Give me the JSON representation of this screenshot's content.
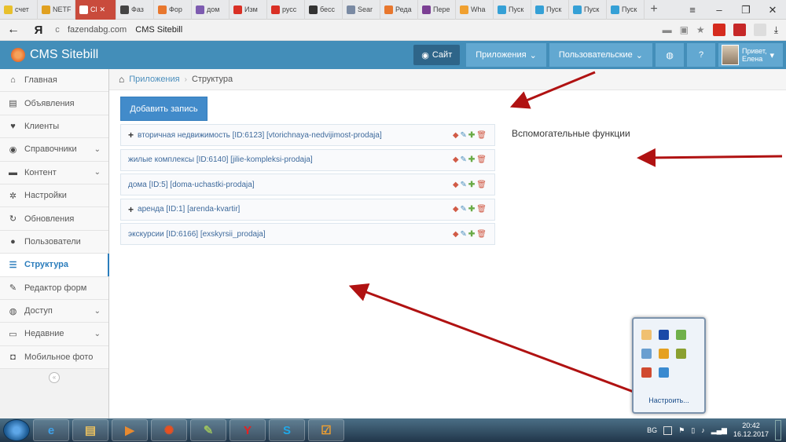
{
  "browser": {
    "tabs": [
      {
        "label": "счет",
        "color": "#e8c02c"
      },
      {
        "label": "NETF",
        "color": "#e0a020"
      },
      {
        "label": "Cl",
        "color": "#ffffff",
        "active": true
      },
      {
        "label": "Фаз",
        "color": "#444444"
      },
      {
        "label": "Фор",
        "color": "#e8772e"
      },
      {
        "label": "дом",
        "color": "#7d5bb0"
      },
      {
        "label": "Изм",
        "color": "#d93025"
      },
      {
        "label": "русс",
        "color": "#d93025"
      },
      {
        "label": "бесс",
        "color": "#333333"
      },
      {
        "label": "Sear",
        "color": "#7a8aa3"
      },
      {
        "label": "Реда",
        "color": "#e8772e"
      },
      {
        "label": "Пере",
        "color": "#7b3f94"
      },
      {
        "label": "Wha",
        "color": "#f0a030"
      },
      {
        "label": "Пуск",
        "color": "#35a0d6"
      },
      {
        "label": "Пуск",
        "color": "#35a0d6"
      },
      {
        "label": "Пуск",
        "color": "#35a0d6"
      },
      {
        "label": "Пуск",
        "color": "#35a0d6"
      }
    ],
    "new_tab": "+",
    "address": {
      "domain": "fazendabg.com",
      "page_title": "CMS Sitebill"
    }
  },
  "header": {
    "brand": "CMS Sitebill",
    "site_button": "Сайт",
    "apps_menu": "Приложения",
    "user_menu": "Пользовательские",
    "greeting_line1": "Привет,",
    "greeting_line2": "Елена"
  },
  "sidebar": {
    "items": [
      {
        "label": "Главная",
        "icon": "home-icon",
        "glyph": "⌂"
      },
      {
        "label": "Объявления",
        "icon": "book-icon",
        "glyph": "▤"
      },
      {
        "label": "Клиенты",
        "icon": "heart-icon",
        "glyph": "♥"
      },
      {
        "label": "Справочники",
        "icon": "globe-icon",
        "glyph": "◉",
        "chevron": true
      },
      {
        "label": "Контент",
        "icon": "keyboard-icon",
        "glyph": "▬",
        "chevron": true
      },
      {
        "label": "Настройки",
        "icon": "gear-icon",
        "glyph": "✲"
      },
      {
        "label": "Обновления",
        "icon": "refresh-icon",
        "glyph": "↻"
      },
      {
        "label": "Пользователи",
        "icon": "user-icon",
        "glyph": "●"
      },
      {
        "label": "Структура",
        "icon": "list-icon",
        "glyph": "☰",
        "active": true
      },
      {
        "label": "Редактор форм",
        "icon": "edit-icon",
        "glyph": "✎"
      },
      {
        "label": "Доступ",
        "icon": "users-icon",
        "glyph": "◍",
        "chevron": true
      },
      {
        "label": "Недавние",
        "icon": "desktop-icon",
        "glyph": "▭",
        "chevron": true
      },
      {
        "label": "Мобильное фото",
        "icon": "camera-icon",
        "glyph": "◘"
      }
    ]
  },
  "breadcrumbs": {
    "link": "Приложения",
    "current": "Структура"
  },
  "main": {
    "add_button": "Добавить запись",
    "aux_title": "Вспомогательные функции",
    "rows": [
      {
        "label": "вторичная недвижимость [ID:6123] [vtorichnaya-nedvijimost-prodaja]",
        "expandable": true
      },
      {
        "label": "жилые комплексы [ID:6140] [jilie-kompleksi-prodaja]",
        "expandable": false
      },
      {
        "label": "дома [ID:5] [doma-uchastki-prodaja]",
        "expandable": false
      },
      {
        "label": "аренда [ID:1] [arenda-kvartir]",
        "expandable": true
      },
      {
        "label": "экскурсии [ID:6166] [exskyrsii_prodaja]",
        "expandable": false
      }
    ]
  },
  "tray_popup": {
    "link": "Настроить..."
  },
  "taskbar": {
    "lang": "BG",
    "time": "20:42",
    "date": "16.12.2017"
  }
}
